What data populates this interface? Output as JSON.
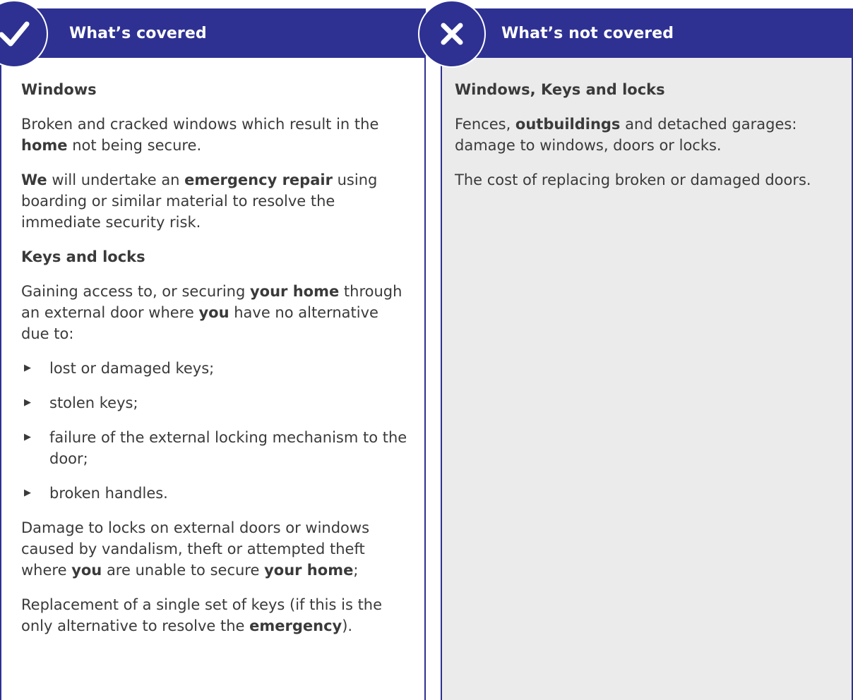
{
  "covered": {
    "header": "What’s covered",
    "windows_heading": "Windows",
    "windows_p1": [
      "Broken and cracked windows which result in the ",
      "home",
      " not being secure."
    ],
    "windows_p2": [
      "We",
      " will undertake an ",
      "emergency repair",
      " using boarding or similar material to resolve the immediate security risk."
    ],
    "keys_heading": "Keys and locks",
    "keys_p1": [
      "Gaining access to, or securing ",
      "your home",
      " through an external door where ",
      "you",
      " have no alternative due to:"
    ],
    "bullets": [
      "lost or damaged keys;",
      "stolen keys;",
      "failure of the external locking mechanism to the door;",
      "broken handles."
    ],
    "damage_p": [
      "Damage to locks on external doors or windows caused by vandalism, theft or attempted theft where ",
      "you",
      " are unable to secure ",
      "your home",
      ";"
    ],
    "replacement_p": [
      "Replacement of a single set of keys (if this is the only alternative to resolve the ",
      "emergency",
      ")."
    ]
  },
  "not_covered": {
    "header": "What’s not covered",
    "heading": "Windows, Keys and locks",
    "p1": [
      "Fences, ",
      "outbuildings",
      " and detached garages: damage to windows, doors or locks."
    ],
    "p2": "The cost of replacing broken or damaged doors."
  },
  "icons": {
    "covered": "check-icon",
    "not_covered": "cross-icon",
    "bullet": "triangle-bullet-icon"
  },
  "colors": {
    "brand": "#2e3192",
    "panel_grey": "#ebebeb",
    "text": "#3a3a3a"
  }
}
